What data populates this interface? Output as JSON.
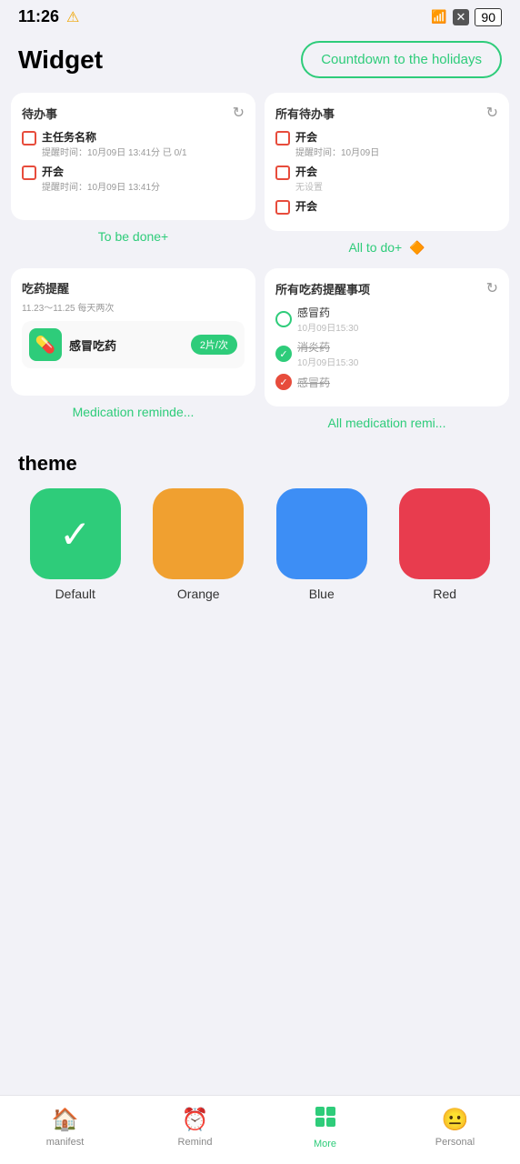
{
  "statusBar": {
    "time": "11:26",
    "warning": "⚠",
    "wifi": "📶",
    "battery": "90"
  },
  "header": {
    "title": "Widget",
    "countdownLabel": "Countdown to the holidays"
  },
  "widgets": {
    "todoCard": {
      "title": "待办事",
      "items": [
        {
          "name": "主任务名称",
          "time": "提醒时间：10月09日 13:41分 已 0/1"
        },
        {
          "name": "开会",
          "time": "提醒时间：10月09日 13:41分"
        }
      ],
      "label": "To be done+"
    },
    "allTodoCard": {
      "title": "所有待办事",
      "items": [
        {
          "name": "开会",
          "time": "提醒时间：10月09日"
        },
        {
          "name": "开会",
          "time": "无设置"
        },
        {
          "name": "开会",
          "time": ""
        }
      ],
      "label": "All to do+",
      "labelIcon": "🔶"
    },
    "medCard": {
      "title": "吃药提醒",
      "schedule": "11.23～11.25 每天两次",
      "item": {
        "name": "感冒吃药",
        "dose": "2片/次"
      },
      "label": "Medication reminde..."
    },
    "allMedCard": {
      "title": "所有吃药提醒事项",
      "items": [
        {
          "name": "感冒药",
          "time": "10月09日15:30",
          "status": "unchecked"
        },
        {
          "name": "消炎药",
          "time": "10月09日15:30",
          "status": "checked-green"
        },
        {
          "name": "感冒药",
          "time": "",
          "status": "checked-red"
        }
      ],
      "label": "All medication remi..."
    }
  },
  "theme": {
    "sectionTitle": "theme",
    "items": [
      {
        "id": "default",
        "label": "Default",
        "color": "#2ecc7a",
        "selected": true
      },
      {
        "id": "orange",
        "label": "Orange",
        "color": "#f0a030",
        "selected": false
      },
      {
        "id": "blue",
        "label": "Blue",
        "color": "#3d8ef5",
        "selected": false
      },
      {
        "id": "red",
        "label": "Red",
        "color": "#e83c4e",
        "selected": false
      }
    ]
  },
  "bottomNav": {
    "items": [
      {
        "id": "manifest",
        "label": "manifest",
        "icon": "🏠",
        "active": false
      },
      {
        "id": "remind",
        "label": "Remind",
        "icon": "⏰",
        "active": false
      },
      {
        "id": "more",
        "label": "More",
        "icon": "⊞",
        "active": true
      },
      {
        "id": "personal",
        "label": "Personal",
        "icon": "😐",
        "active": false
      }
    ]
  }
}
